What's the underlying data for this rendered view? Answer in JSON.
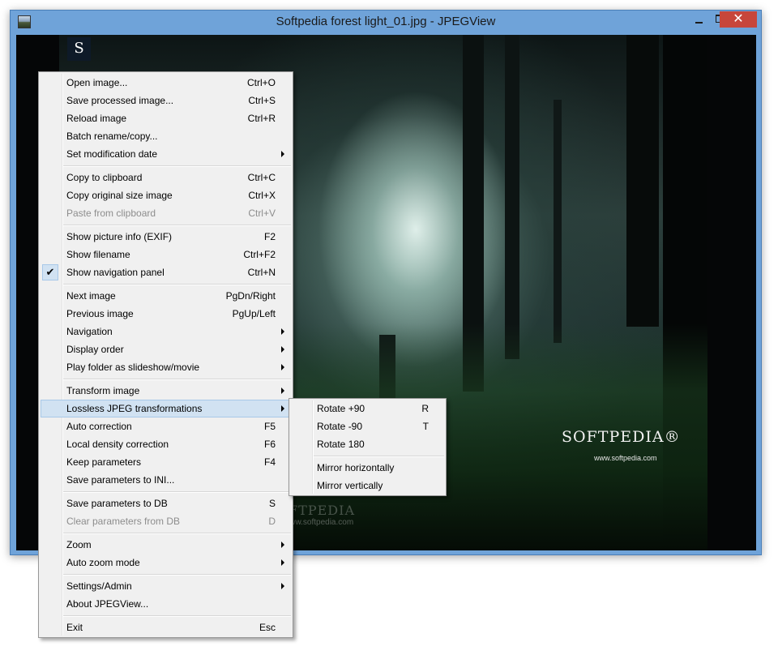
{
  "window": {
    "title": "Softpedia forest light_01.jpg - JPEGView",
    "close_glyph": "✕",
    "minimize_icon": "minimize-icon",
    "maximize_icon": "maximize-icon"
  },
  "image": {
    "logo_text": "SOFTPEDIA®",
    "logo_url": "www.softpedia.com",
    "watermark_text": "SOFTPEDIA",
    "watermark_url": "www.softpedia.com",
    "nav_badge": "S"
  },
  "main_menu": {
    "items": [
      {
        "label": "Open image...",
        "shortcut": "Ctrl+O"
      },
      {
        "label": "Save processed image...",
        "shortcut": "Ctrl+S"
      },
      {
        "label": "Reload image",
        "shortcut": "Ctrl+R"
      },
      {
        "label": "Batch rename/copy...",
        "shortcut": ""
      },
      {
        "label": "Set modification date",
        "shortcut": "",
        "submenu": true
      },
      {
        "label": "Copy to clipboard",
        "shortcut": "Ctrl+C"
      },
      {
        "label": "Copy original size image",
        "shortcut": "Ctrl+X"
      },
      {
        "label": "Paste from clipboard",
        "shortcut": "Ctrl+V",
        "disabled": true
      },
      {
        "label": "Show picture info (EXIF)",
        "shortcut": "F2"
      },
      {
        "label": "Show filename",
        "shortcut": "Ctrl+F2"
      },
      {
        "label": "Show navigation panel",
        "shortcut": "Ctrl+N",
        "checked": true
      },
      {
        "label": "Next image",
        "shortcut": "PgDn/Right"
      },
      {
        "label": "Previous image",
        "shortcut": "PgUp/Left"
      },
      {
        "label": "Navigation",
        "shortcut": "",
        "submenu": true
      },
      {
        "label": "Display order",
        "shortcut": "",
        "submenu": true
      },
      {
        "label": "Play folder as slideshow/movie",
        "shortcut": "",
        "submenu": true
      },
      {
        "label": "Transform image",
        "shortcut": "",
        "submenu": true
      },
      {
        "label": "Lossless JPEG transformations",
        "shortcut": "",
        "submenu": true,
        "highlighted": true
      },
      {
        "label": "Auto correction",
        "shortcut": "F5"
      },
      {
        "label": "Local density correction",
        "shortcut": "F6"
      },
      {
        "label": "Keep parameters",
        "shortcut": "F4"
      },
      {
        "label": "Save parameters to INI...",
        "shortcut": ""
      },
      {
        "label": "Save parameters to DB",
        "shortcut": "S"
      },
      {
        "label": "Clear parameters from DB",
        "shortcut": "D",
        "disabled": true
      },
      {
        "label": "Zoom",
        "shortcut": "",
        "submenu": true
      },
      {
        "label": "Auto zoom mode",
        "shortcut": "",
        "submenu": true
      },
      {
        "label": "Settings/Admin",
        "shortcut": "",
        "submenu": true
      },
      {
        "label": "About JPEGView...",
        "shortcut": ""
      },
      {
        "label": "Exit",
        "shortcut": "Esc"
      }
    ],
    "check_glyph": "✔"
  },
  "sub_menu": {
    "items": [
      {
        "label": "Rotate +90",
        "shortcut": "R"
      },
      {
        "label": "Rotate -90",
        "shortcut": "T"
      },
      {
        "label": "Rotate 180",
        "shortcut": ""
      },
      {
        "label": "Mirror horizontally",
        "shortcut": ""
      },
      {
        "label": "Mirror vertically",
        "shortcut": ""
      }
    ]
  }
}
